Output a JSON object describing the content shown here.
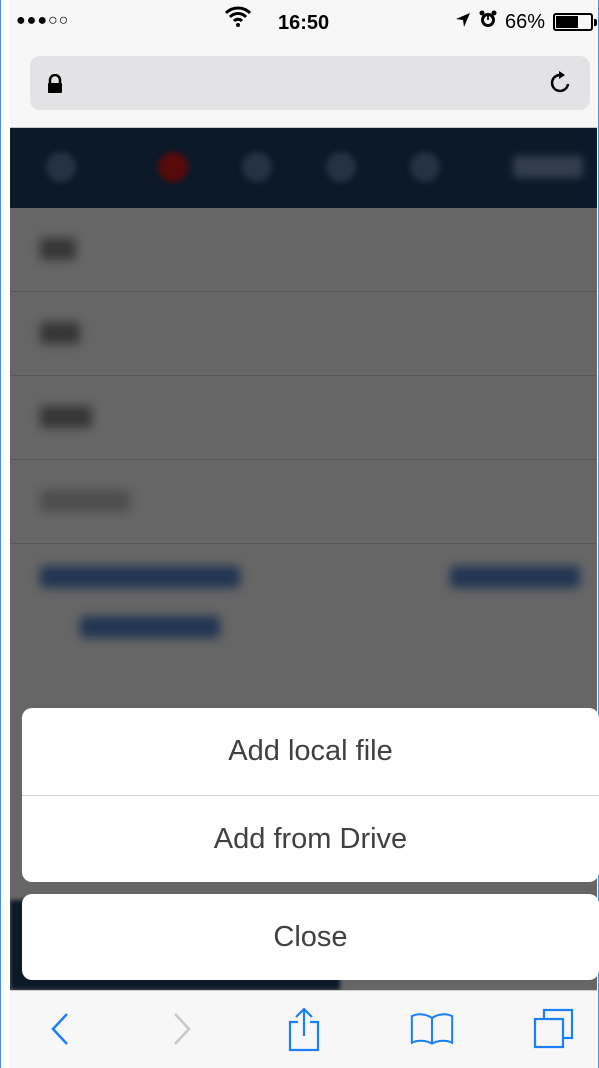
{
  "status_bar": {
    "signal": "●●●○○",
    "time": "16:50",
    "battery_percent": "66%",
    "battery_level": 0.66
  },
  "address_bar": {
    "url_text": ""
  },
  "action_sheet": {
    "options": [
      {
        "label": "Add local file"
      },
      {
        "label": "Add from Drive"
      }
    ],
    "close_label": "Close"
  },
  "toolbar": {
    "icons": [
      "back-icon",
      "forward-icon",
      "share-icon",
      "bookmarks-icon",
      "tabs-icon"
    ]
  },
  "colors": {
    "accent": "#1a7ffb",
    "disabled": "#c7c7cc",
    "header_bg": "#1c3f66"
  }
}
